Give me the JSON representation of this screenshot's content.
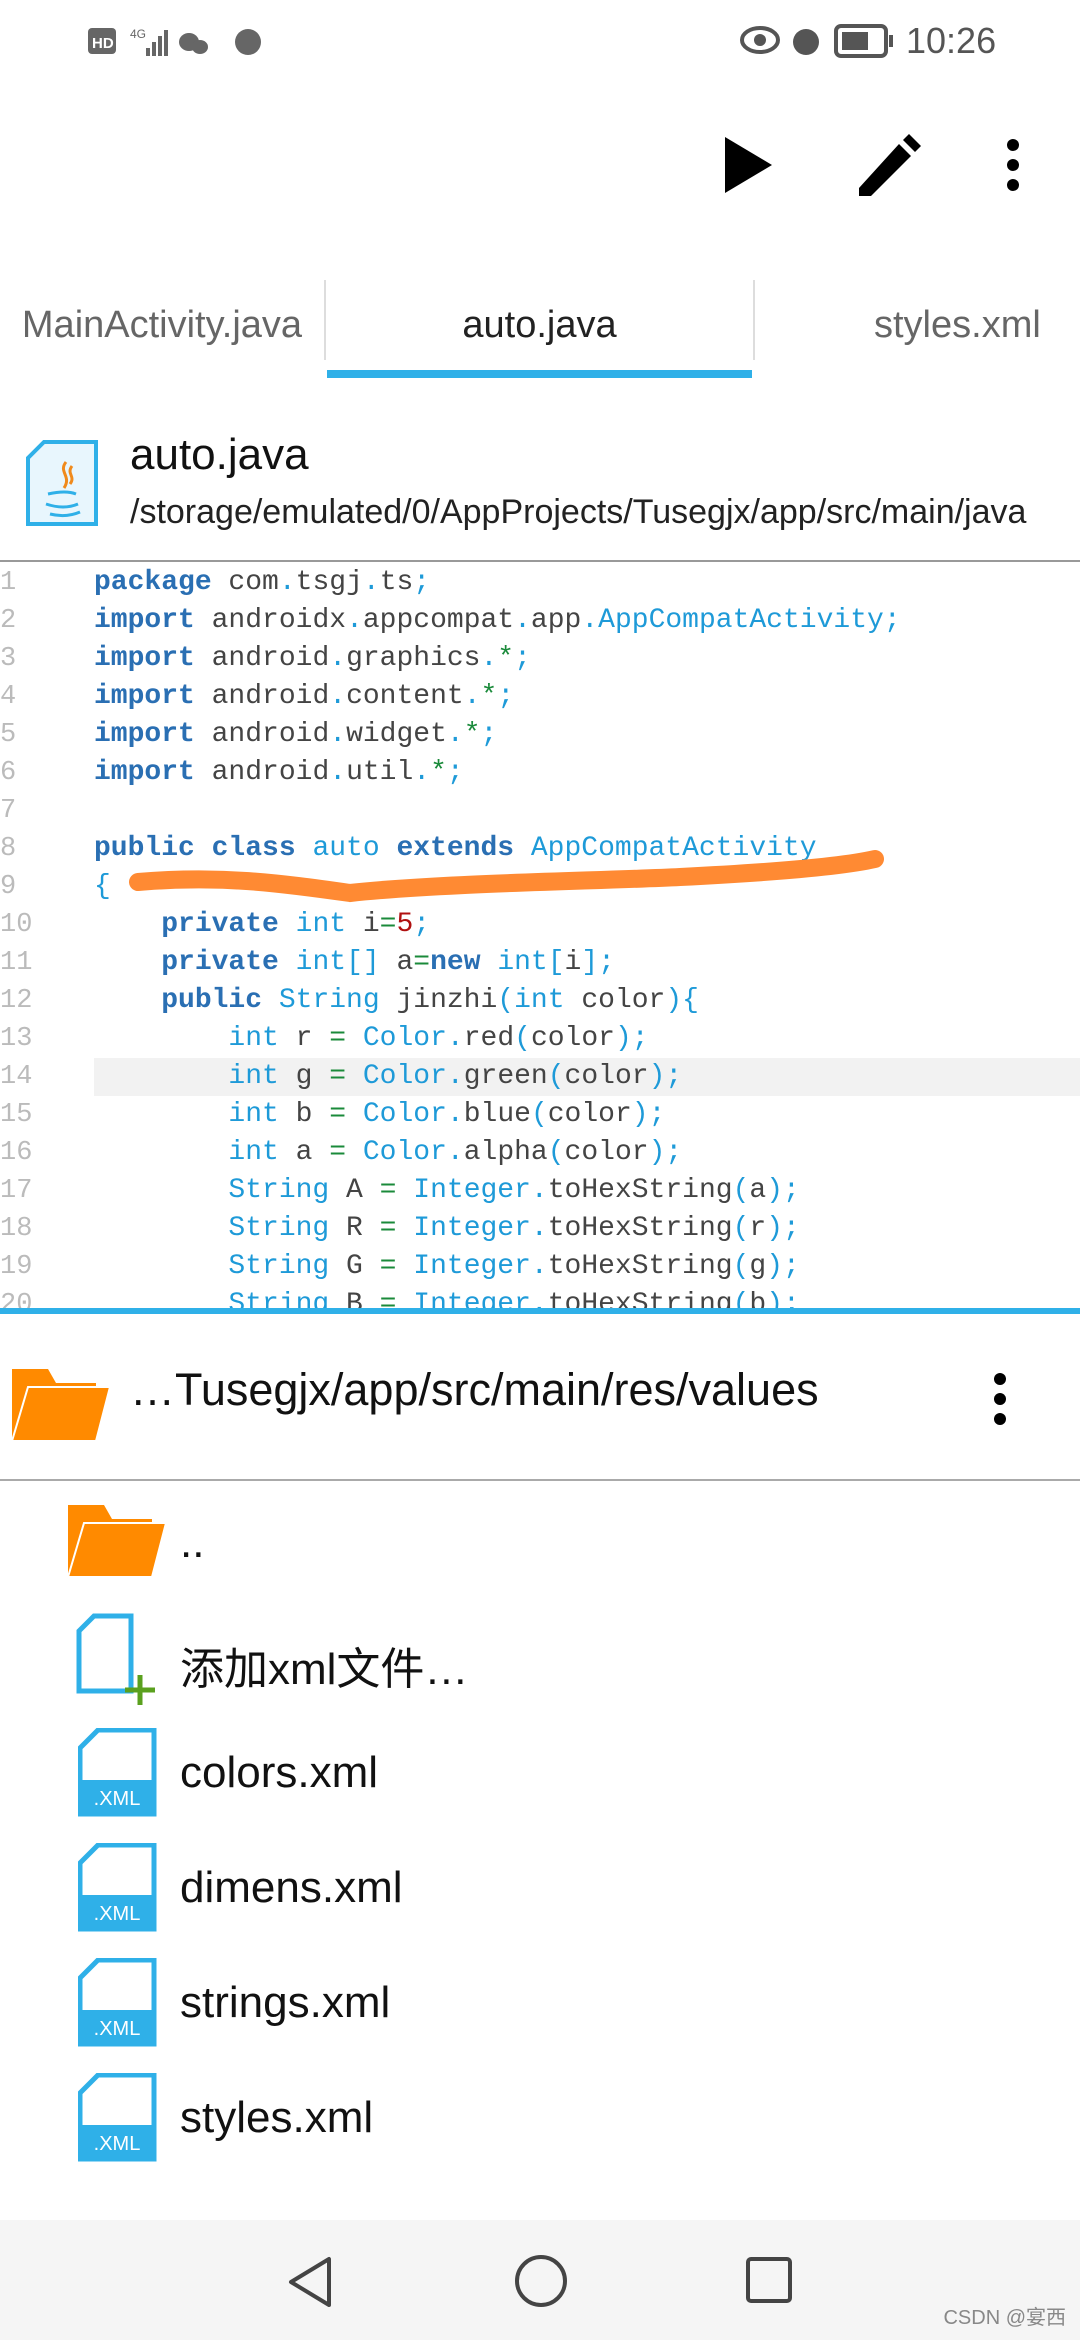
{
  "status_bar": {
    "time": "10:26",
    "left_icons": [
      "hd-icon",
      "4g-signal-icon",
      "wechat-icon",
      "browser-icon"
    ],
    "right_icons": [
      "eye-icon",
      "alarm-icon",
      "battery-icon"
    ]
  },
  "toolbar": {
    "icons": [
      "play-icon",
      "pencil-icon",
      "more-vert-icon"
    ]
  },
  "tabs": [
    {
      "label": "MainActivity.java",
      "visible": "inActivity.java"
    },
    {
      "label": "auto.java",
      "active": true
    },
    {
      "label": "styles.xml"
    }
  ],
  "file_header": {
    "title": "auto.java",
    "path": "/storage/emulated/0/AppProjects/Tusegjx/app/src/main/java"
  },
  "code": {
    "highlighted_line": 14,
    "lines": [
      [
        [
          "kw",
          "package"
        ],
        [
          "id",
          " com"
        ],
        [
          "pu",
          "."
        ],
        [
          "id",
          "tsgj"
        ],
        [
          "pu",
          "."
        ],
        [
          "id",
          "ts"
        ],
        [
          "pu",
          ";"
        ]
      ],
      [
        [
          "kw",
          "import"
        ],
        [
          "id",
          " androidx"
        ],
        [
          "pu",
          "."
        ],
        [
          "id",
          "appcompat"
        ],
        [
          "pu",
          "."
        ],
        [
          "id",
          "app"
        ],
        [
          "pu",
          "."
        ],
        [
          "ty",
          "AppCompatActivity"
        ],
        [
          "pu",
          ";"
        ]
      ],
      [
        [
          "kw",
          "import"
        ],
        [
          "id",
          " android"
        ],
        [
          "pu",
          "."
        ],
        [
          "id",
          "graphics"
        ],
        [
          "pu",
          "."
        ],
        [
          "op",
          "*"
        ],
        [
          "pu",
          ";"
        ]
      ],
      [
        [
          "kw",
          "import"
        ],
        [
          "id",
          " android"
        ],
        [
          "pu",
          "."
        ],
        [
          "id",
          "content"
        ],
        [
          "pu",
          "."
        ],
        [
          "op",
          "*"
        ],
        [
          "pu",
          ";"
        ]
      ],
      [
        [
          "kw",
          "import"
        ],
        [
          "id",
          " android"
        ],
        [
          "pu",
          "."
        ],
        [
          "id",
          "widget"
        ],
        [
          "pu",
          "."
        ],
        [
          "op",
          "*"
        ],
        [
          "pu",
          ";"
        ]
      ],
      [
        [
          "kw",
          "import"
        ],
        [
          "id",
          " android"
        ],
        [
          "pu",
          "."
        ],
        [
          "id",
          "util"
        ],
        [
          "pu",
          "."
        ],
        [
          "op",
          "*"
        ],
        [
          "pu",
          ";"
        ]
      ],
      [],
      [
        [
          "kw",
          "public class"
        ],
        [
          "ty",
          " auto"
        ],
        [
          "kw",
          " extends"
        ],
        [
          "ty",
          " AppCompatActivity"
        ]
      ],
      [
        [
          "pu",
          "{"
        ]
      ],
      [
        [
          "id",
          "    "
        ],
        [
          "kw",
          "private"
        ],
        [
          "ty",
          " int"
        ],
        [
          "id",
          " i"
        ],
        [
          "op",
          "="
        ],
        [
          "nu",
          "5"
        ],
        [
          "pu",
          ";"
        ]
      ],
      [
        [
          "id",
          "    "
        ],
        [
          "kw",
          "private"
        ],
        [
          "ty",
          " int"
        ],
        [
          "pu",
          "[]"
        ],
        [
          "id",
          " a"
        ],
        [
          "op",
          "="
        ],
        [
          "kw",
          "new"
        ],
        [
          "ty",
          " int"
        ],
        [
          "pu",
          "["
        ],
        [
          "id",
          "i"
        ],
        [
          "pu",
          "];"
        ]
      ],
      [
        [
          "id",
          "    "
        ],
        [
          "kw",
          "public"
        ],
        [
          "ty",
          " String"
        ],
        [
          "id",
          " jinzhi"
        ],
        [
          "pu",
          "("
        ],
        [
          "ty",
          "int"
        ],
        [
          "id",
          " color"
        ],
        [
          "pu",
          "){"
        ]
      ],
      [
        [
          "id",
          "        "
        ],
        [
          "ty",
          "int"
        ],
        [
          "id",
          " r "
        ],
        [
          "op",
          "="
        ],
        [
          "ty",
          " Color"
        ],
        [
          "pu",
          "."
        ],
        [
          "id",
          "red"
        ],
        [
          "pu",
          "("
        ],
        [
          "id",
          "color"
        ],
        [
          "pu",
          ");"
        ]
      ],
      [
        [
          "id",
          "        "
        ],
        [
          "ty",
          "int"
        ],
        [
          "id",
          " g "
        ],
        [
          "op",
          "="
        ],
        [
          "ty",
          " Color"
        ],
        [
          "pu",
          "."
        ],
        [
          "id",
          "green"
        ],
        [
          "pu",
          "("
        ],
        [
          "id",
          "color"
        ],
        [
          "pu",
          ");"
        ]
      ],
      [
        [
          "id",
          "        "
        ],
        [
          "ty",
          "int"
        ],
        [
          "id",
          " b "
        ],
        [
          "op",
          "="
        ],
        [
          "ty",
          " Color"
        ],
        [
          "pu",
          "."
        ],
        [
          "id",
          "blue"
        ],
        [
          "pu",
          "("
        ],
        [
          "id",
          "color"
        ],
        [
          "pu",
          ");"
        ]
      ],
      [
        [
          "id",
          "        "
        ],
        [
          "ty",
          "int"
        ],
        [
          "id",
          " a "
        ],
        [
          "op",
          "="
        ],
        [
          "ty",
          " Color"
        ],
        [
          "pu",
          "."
        ],
        [
          "id",
          "alpha"
        ],
        [
          "pu",
          "("
        ],
        [
          "id",
          "color"
        ],
        [
          "pu",
          ");"
        ]
      ],
      [
        [
          "id",
          "        "
        ],
        [
          "ty",
          "String"
        ],
        [
          "id",
          " A "
        ],
        [
          "op",
          "="
        ],
        [
          "ty",
          " Integer"
        ],
        [
          "pu",
          "."
        ],
        [
          "id",
          "toHexString"
        ],
        [
          "pu",
          "("
        ],
        [
          "id",
          "a"
        ],
        [
          "pu",
          ");"
        ]
      ],
      [
        [
          "id",
          "        "
        ],
        [
          "ty",
          "String"
        ],
        [
          "id",
          " R "
        ],
        [
          "op",
          "="
        ],
        [
          "ty",
          " Integer"
        ],
        [
          "pu",
          "."
        ],
        [
          "id",
          "toHexString"
        ],
        [
          "pu",
          "("
        ],
        [
          "id",
          "r"
        ],
        [
          "pu",
          ");"
        ]
      ],
      [
        [
          "id",
          "        "
        ],
        [
          "ty",
          "String"
        ],
        [
          "id",
          " G "
        ],
        [
          "op",
          "="
        ],
        [
          "ty",
          " Integer"
        ],
        [
          "pu",
          "."
        ],
        [
          "id",
          "toHexString"
        ],
        [
          "pu",
          "("
        ],
        [
          "id",
          "g"
        ],
        [
          "pu",
          ");"
        ]
      ],
      [
        [
          "id",
          "        "
        ],
        [
          "ty",
          "String"
        ],
        [
          "id",
          " B "
        ],
        [
          "op",
          "="
        ],
        [
          "ty",
          " Integer"
        ],
        [
          "pu",
          "."
        ],
        [
          "id",
          "toHexString"
        ],
        [
          "pu",
          "("
        ],
        [
          "id",
          "b"
        ],
        [
          "pu",
          ");"
        ]
      ]
    ]
  },
  "browser": {
    "path": "…Tusegjx/app/src/main/res/values",
    "items": [
      {
        "label": "..",
        "icon": "folder-icon"
      },
      {
        "label": "添加xml文件…",
        "icon": "add-file-icon"
      },
      {
        "label": "colors.xml",
        "icon": "xml-file-icon"
      },
      {
        "label": "dimens.xml",
        "icon": "xml-file-icon"
      },
      {
        "label": "strings.xml",
        "icon": "xml-file-icon"
      },
      {
        "label": "styles.xml",
        "icon": "xml-file-icon"
      }
    ],
    "xml_badge": ".XML"
  },
  "nav": {
    "icons": [
      "back-icon",
      "home-icon",
      "recents-icon"
    ]
  },
  "watermark": "CSDN @宴西",
  "colors": {
    "accent": "#2fb0e8",
    "folder": "#ff8a00",
    "annotation": "#ff8a33"
  }
}
